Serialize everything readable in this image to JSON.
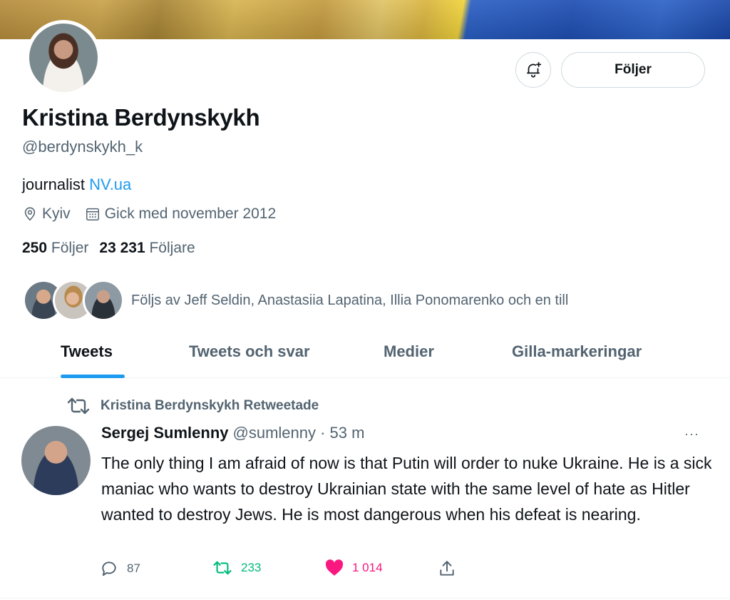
{
  "profile": {
    "name": "Kristina Berdynskykh",
    "handle": "@berdynskykh_k",
    "bio_text": "journalist ",
    "bio_link": "NV.ua",
    "location": "Kyiv",
    "joined": "Gick med november 2012",
    "following_count": "250",
    "following_label": "Följer",
    "followers_count": "23 231",
    "followers_label": "Följare",
    "followed_by": "Följs av Jeff Seldin, Anastasiia Lapatina, Illia Ponomarenko och en till"
  },
  "header": {
    "follow_button": "Följer",
    "bell_icon": "bell-plus-icon"
  },
  "tabs": [
    {
      "label": "Tweets",
      "active": true
    },
    {
      "label": "Tweets och svar",
      "active": false
    },
    {
      "label": "Medier",
      "active": false
    },
    {
      "label": "Gilla-markeringar",
      "active": false
    }
  ],
  "tweet": {
    "retweet_notice": "Kristina Berdynskykh Retweetade",
    "author_name": "Sergej Sumlenny",
    "author_handle_time": "@sumlenny · 53 m",
    "more": "···",
    "text": "The only thing I am afraid of now is that Putin will order to nuke Ukraine. He is a sick maniac who wants to destroy Ukrainian state with the same level of hate as Hitler wanted to destroy Jews. He is most dangerous when his defeat is nearing.",
    "replies": "87",
    "retweets": "233",
    "likes": "1 014"
  },
  "colors": {
    "accent": "#1d9bf0",
    "retweet_green": "#00ba7c",
    "like_pink": "#f91880",
    "secondary_text": "#536471"
  }
}
